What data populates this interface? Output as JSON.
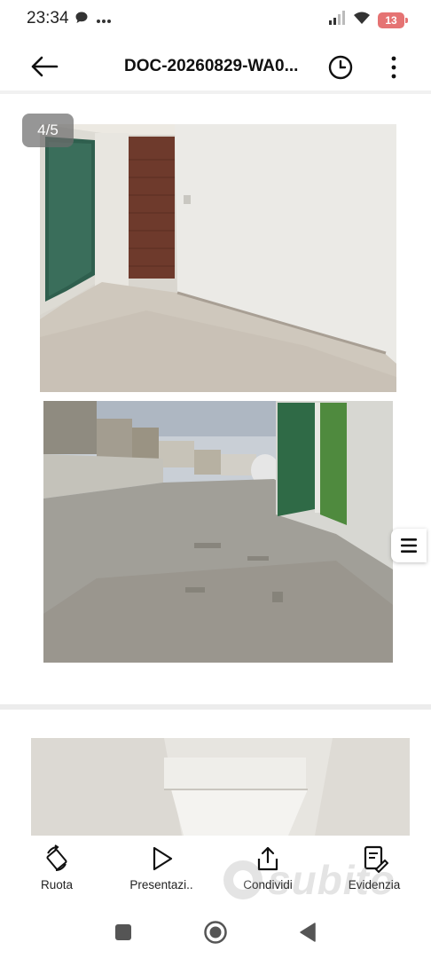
{
  "status_bar": {
    "time": "23:34",
    "battery_level": "13",
    "icons": [
      "chat-bubble-icon",
      "more-dots-icon",
      "signal-icon",
      "wifi-icon",
      "battery-icon"
    ]
  },
  "app_bar": {
    "title": "DOC-20260829-WA0...",
    "back_icon": "arrow-left-icon",
    "history_icon": "clock-icon",
    "more_icon": "vertical-dots-icon"
  },
  "viewer": {
    "page_counter": "4/5",
    "side_menu_icon": "hamburger-menu-icon",
    "pages": [
      {
        "photos": [
          "interior room with green and brown doors",
          "exterior yard with concrete ground"
        ]
      },
      {
        "photos": [
          "interior stair detail"
        ]
      }
    ]
  },
  "toolbar": {
    "items": [
      {
        "label": "Ruota",
        "icon": "rotate-icon"
      },
      {
        "label": "Presentazi..",
        "icon": "play-icon"
      },
      {
        "label": "Condividi",
        "icon": "share-icon"
      },
      {
        "label": "Evidenzia",
        "icon": "highlight-icon"
      }
    ]
  },
  "watermark": {
    "text": "subito"
  },
  "nav_bar": {
    "icons": [
      "recents-square-icon",
      "home-circle-icon",
      "back-triangle-icon"
    ]
  },
  "colors": {
    "battery": "#e57373",
    "counter_bg": "#6e6e6e",
    "divider": "#ececec"
  }
}
